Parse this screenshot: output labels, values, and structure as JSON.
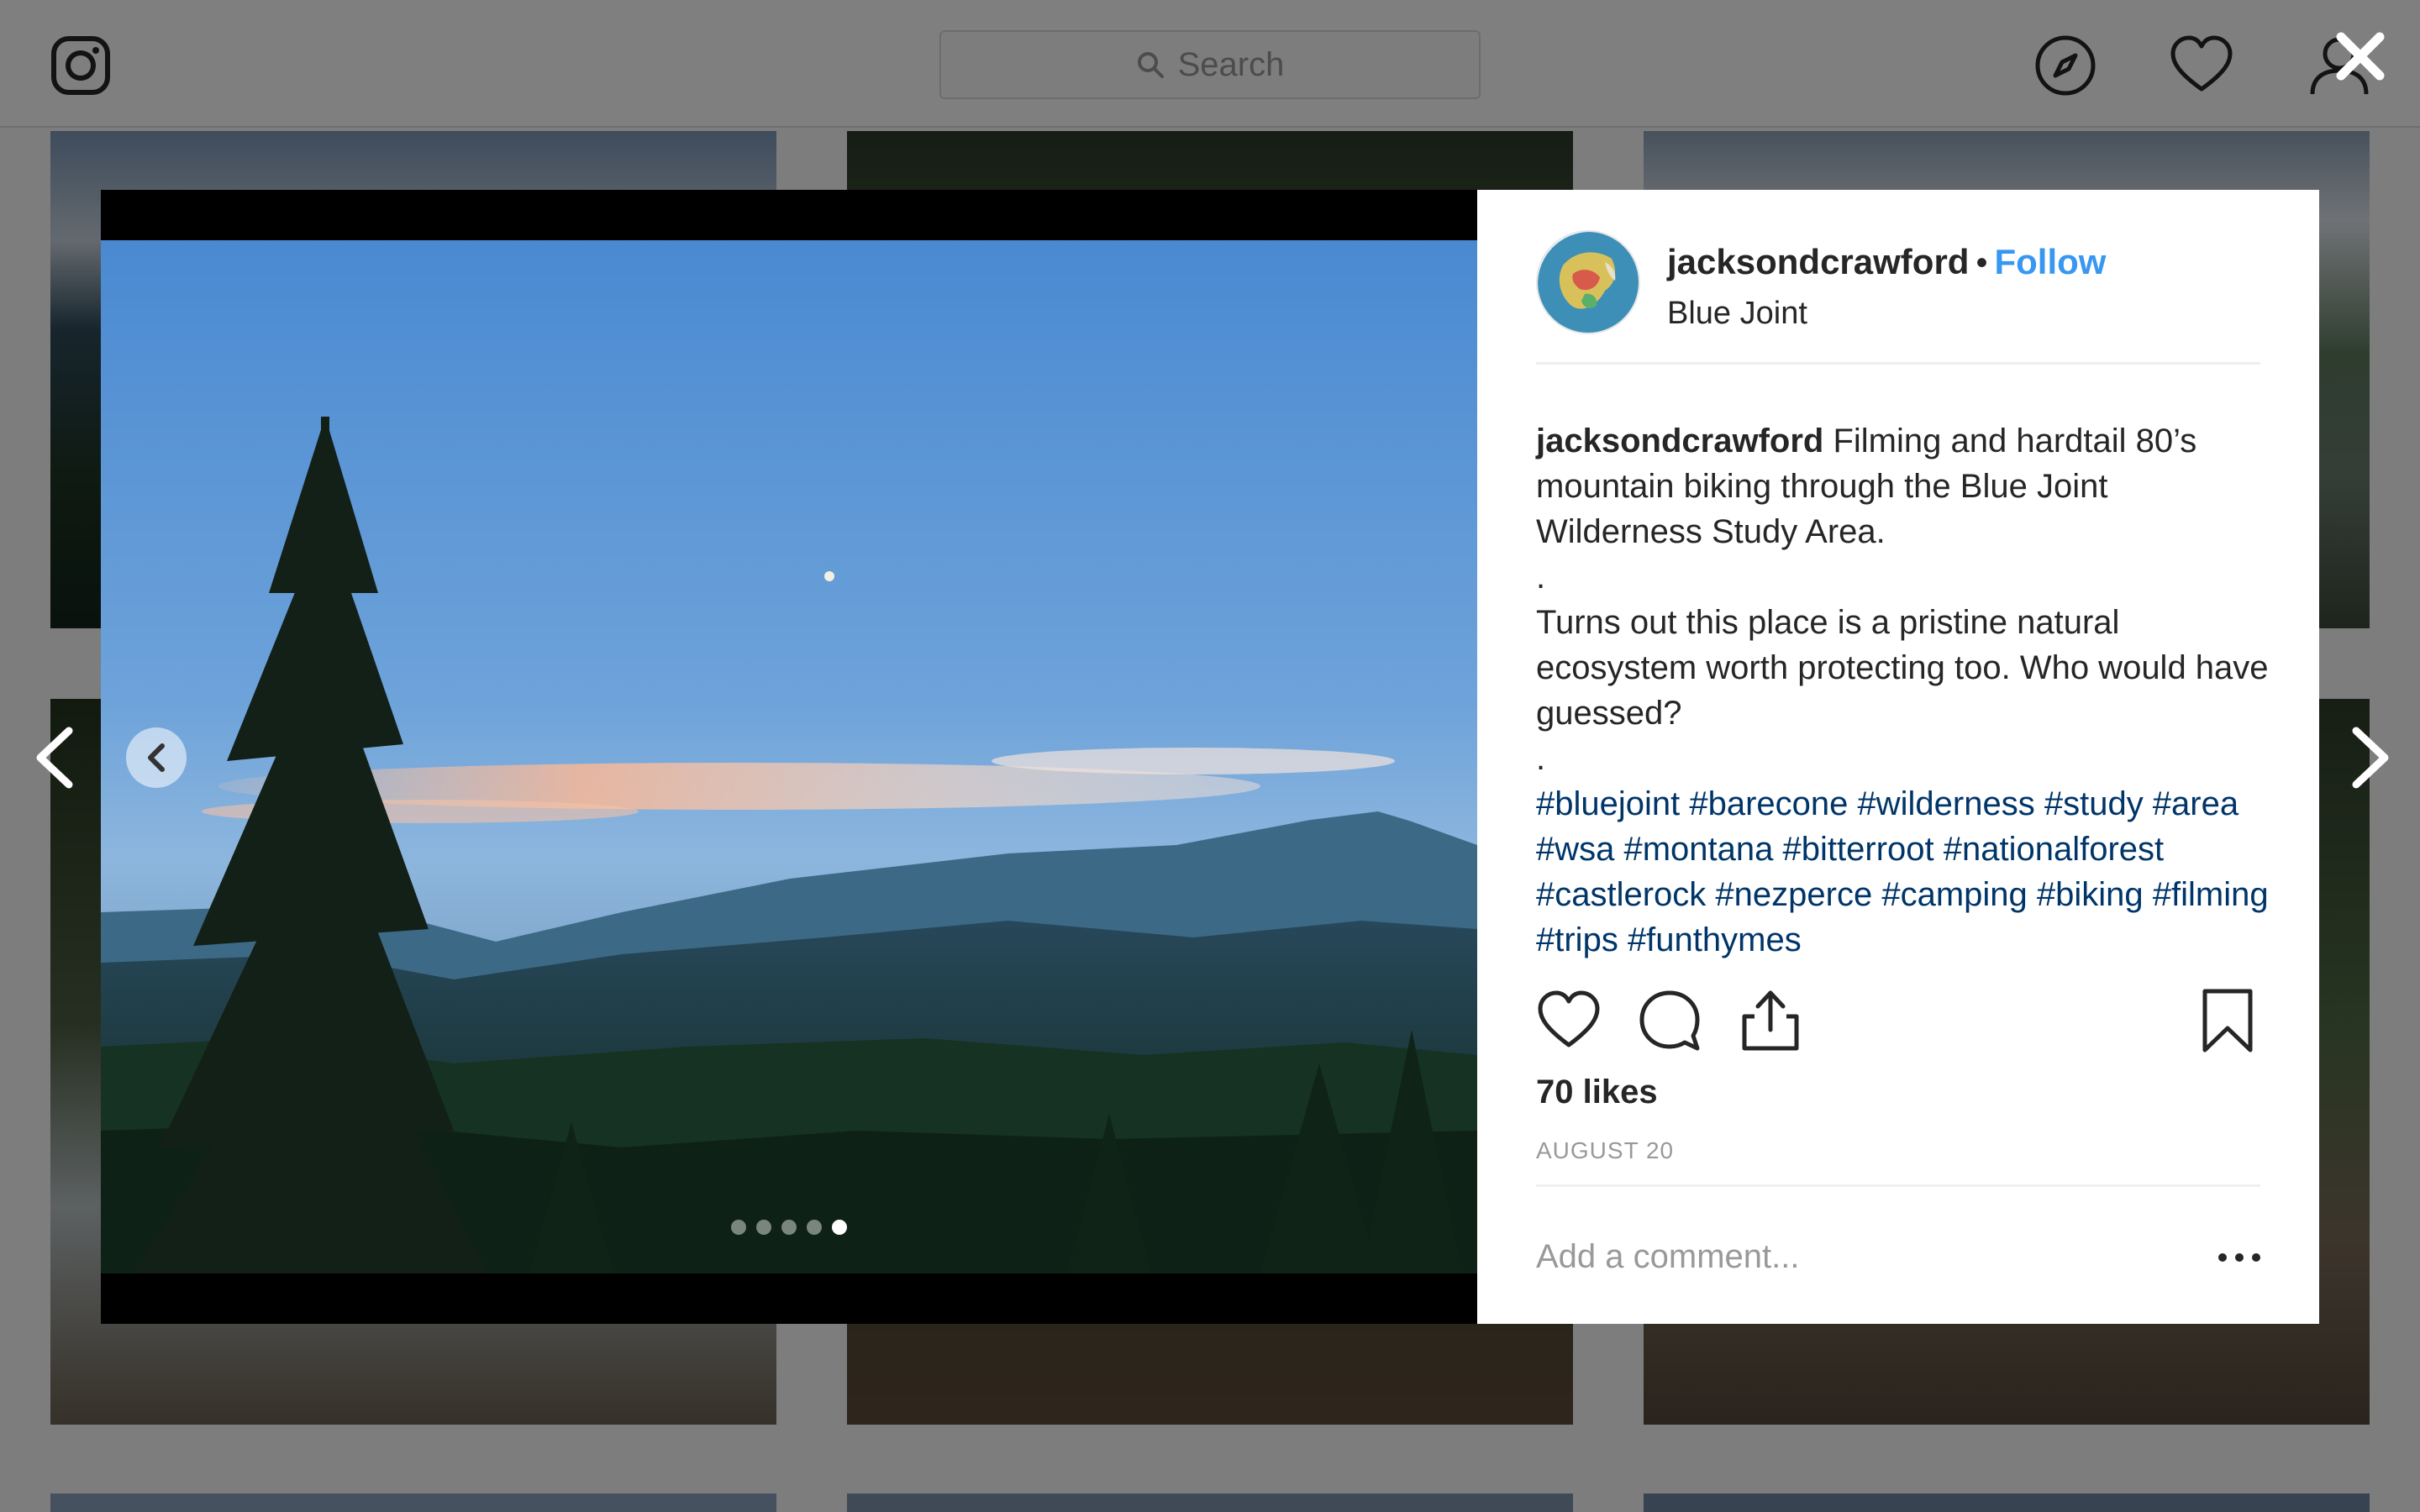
{
  "search": {
    "placeholder": "Search"
  },
  "post": {
    "username": "jacksondcrawford",
    "follow_label": "Follow",
    "location": "Blue Joint",
    "caption_user": "jacksondcrawford",
    "caption_line1": "Filming and hardtail 80’s mountain biking through the Blue Joint Wilderness Study Area.",
    "caption_sep1": ".",
    "caption_line2": "Turns out this place is a pristine natural ecosystem worth protecting too. Who would have guessed?",
    "caption_sep2": ".",
    "hashtags": "#bluejoint #barecone #wilderness #study #area #wsa #montana #bitterroot #nationalforest #castlerock #nezperce #camping #biking #filming #trips #funthymes",
    "likes": "70 likes",
    "date": "AUGUST 20",
    "carousel_total": 5,
    "carousel_active_index": 4
  },
  "comment": {
    "placeholder": "Add a comment..."
  },
  "colors": {
    "follow_blue": "#3897f0",
    "hashtag_blue": "#003569",
    "text_dark": "#262626",
    "text_muted": "#999999"
  },
  "icons": {
    "nav": [
      "instagram-logo-icon",
      "search-icon",
      "compass-icon",
      "heart-icon",
      "user-icon"
    ],
    "modal": [
      "close-icon",
      "chevron-left-icon",
      "chevron-right-icon"
    ],
    "actions": [
      "heart-icon",
      "comment-icon",
      "share-icon",
      "bookmark-icon",
      "more-icon"
    ]
  }
}
